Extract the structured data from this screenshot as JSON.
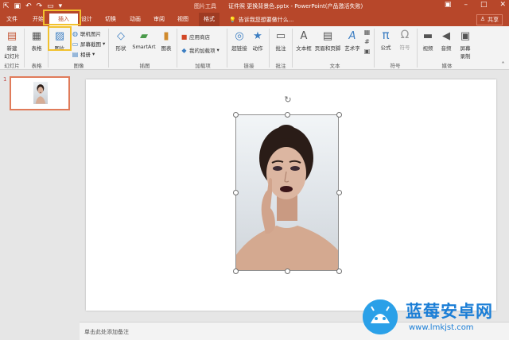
{
  "titlebar": {
    "qat_icons": [
      "fullscreen-icon",
      "save-icon",
      "undo-icon",
      "redo-icon",
      "start-slideshow-icon",
      "customize-icon"
    ],
    "context_title": "图片工具",
    "doc_title": "证件照 更换背景色.pptx - PowerPoint(产品激活失败)"
  },
  "tabs": [
    {
      "label": "文件"
    },
    {
      "label": "开始"
    },
    {
      "label": "插入",
      "active": true
    },
    {
      "label": "设计"
    },
    {
      "label": "切换"
    },
    {
      "label": "动画"
    },
    {
      "label": "审阅"
    },
    {
      "label": "视图"
    },
    {
      "label": "格式"
    }
  ],
  "tellme": "告诉我您想要做什么...",
  "share": "共享",
  "ribbon": {
    "slides": {
      "new_slide": "新建\n幻灯片",
      "group": "幻灯片"
    },
    "tables": {
      "table": "表格",
      "group": "表格"
    },
    "images": {
      "picture": "图片",
      "online_pictures": "联机图片",
      "screenshot": "屏幕截图",
      "album": "相册",
      "group": "图像"
    },
    "illustrations": {
      "shapes": "形状",
      "smartart": "SmartArt",
      "chart": "图表",
      "group": "插图"
    },
    "addins": {
      "store": "应用商店",
      "my_addins": "我的加载项",
      "group": "加载项"
    },
    "links": {
      "hyperlink": "超链接",
      "action": "动作",
      "group": "链接"
    },
    "comments": {
      "comment": "批注",
      "group": "批注"
    },
    "text": {
      "textbox": "文本框",
      "header_footer": "页眉和页脚",
      "wordart": "艺术字",
      "group": "文本"
    },
    "symbols": {
      "equation": "公式",
      "symbol": "符号",
      "group": "符号"
    },
    "media": {
      "video": "视频",
      "audio": "音频",
      "screen_recording": "屏幕\n录制",
      "group": "媒体"
    }
  },
  "thumbnails": [
    {
      "number": "1"
    }
  ],
  "notes_placeholder": "单击此处添加备注",
  "watermark": {
    "title": "蓝莓安卓网",
    "url": "www.lmkjst.com"
  },
  "colors": {
    "accent": "#b7472a",
    "highlight": "#f2c12e",
    "selection": "#e07b5a"
  }
}
